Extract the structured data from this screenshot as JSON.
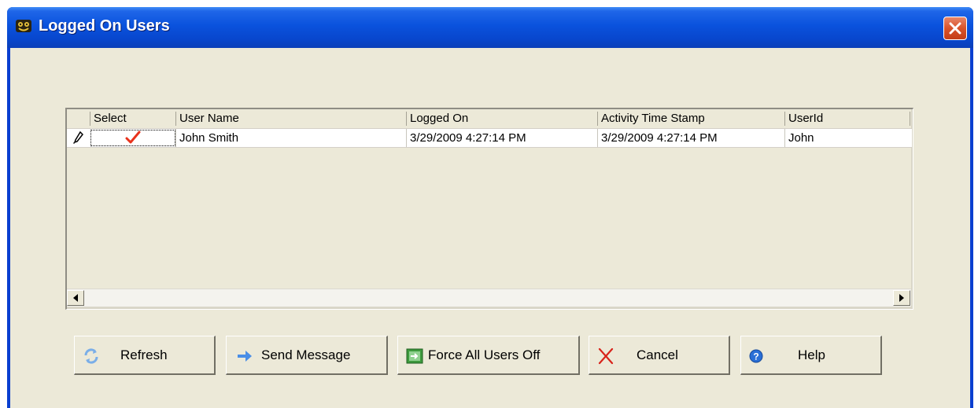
{
  "window": {
    "title": "Logged On Users",
    "icons": {
      "app": "app-icon",
      "close": "close-icon"
    }
  },
  "grid": {
    "columns": [
      "Select",
      "User Name",
      "Logged On",
      "Activity Time Stamp",
      "UserId"
    ],
    "rows": [
      {
        "selected": true,
        "select_icon": "checkmark-icon",
        "row_icon": "pencil-icon",
        "user_name": "John Smith",
        "logged_on": "3/29/2009 4:27:14 PM",
        "activity_time_stamp": "3/29/2009 4:27:14 PM",
        "user_id": "John"
      }
    ],
    "scrollbar": {
      "left_icon": "scroll-left-icon",
      "right_icon": "scroll-right-icon"
    }
  },
  "buttons": {
    "refresh": {
      "label": "Refresh",
      "icon": "refresh-icon"
    },
    "send_message": {
      "label": "Send Message",
      "icon": "arrow-right-icon"
    },
    "force_off": {
      "label": "Force All Users Off",
      "icon": "force-logoff-icon"
    },
    "cancel": {
      "label": "Cancel",
      "icon": "cancel-x-icon"
    },
    "help": {
      "label": "Help",
      "icon": "help-icon"
    }
  },
  "colors": {
    "titlebar": "#0a52dd",
    "close_button": "#d9532a",
    "dialog_background": "#ece9d8",
    "checkmark": "#e8321c",
    "cancel_x": "#d8231a",
    "help_icon": "#2a6fd6",
    "send_arrow": "#4a8ee6",
    "force_icon": "#3d9a3d"
  }
}
